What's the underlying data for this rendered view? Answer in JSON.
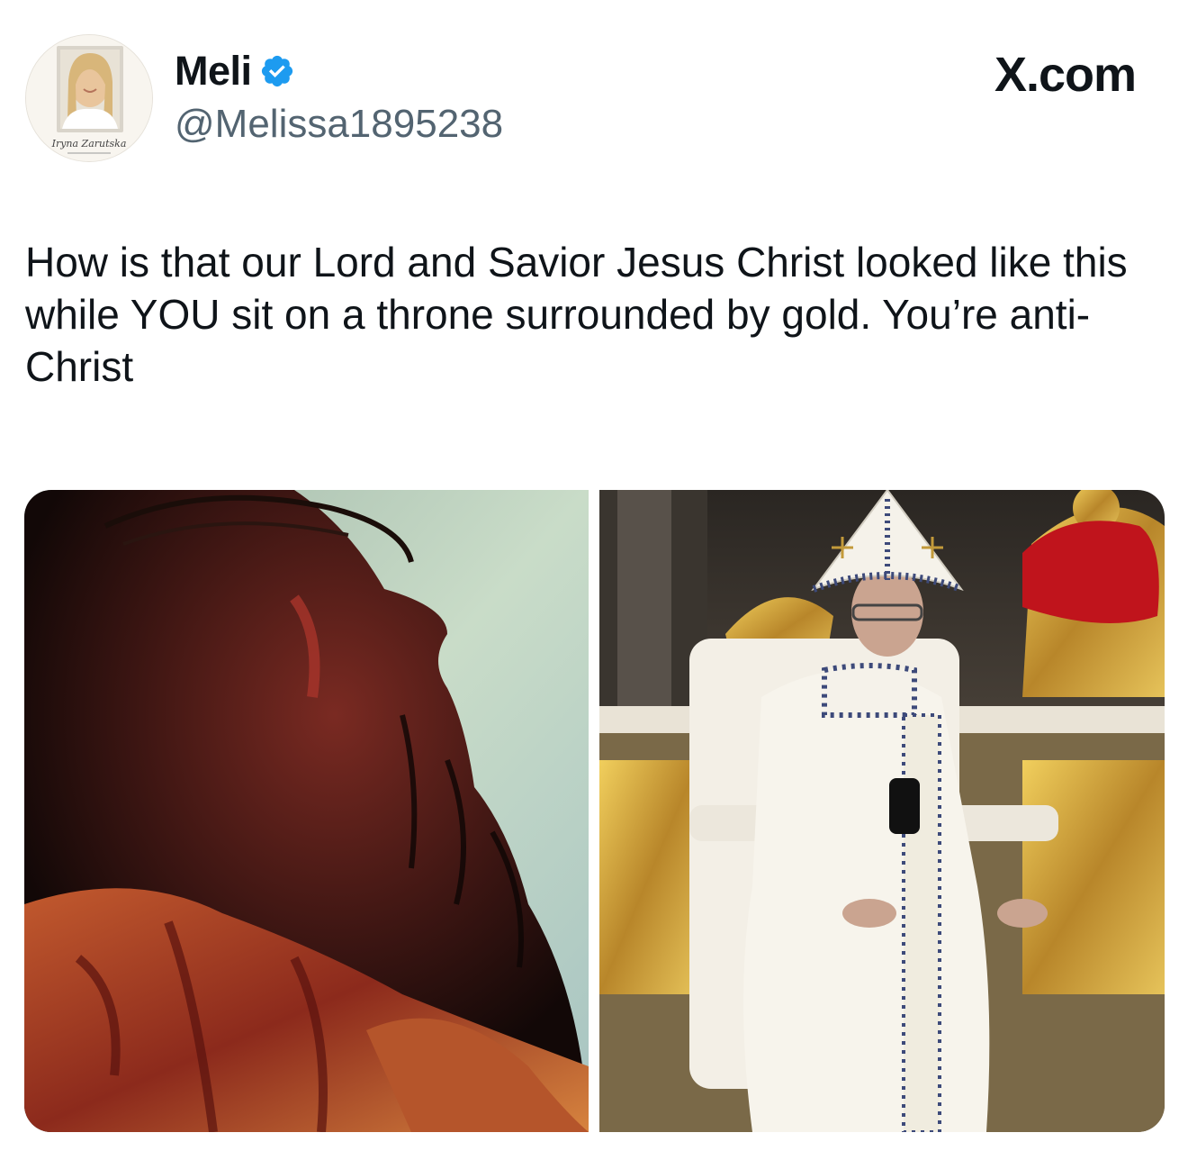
{
  "tweet": {
    "author": {
      "display_name": "Meli",
      "handle": "@Melissa1895238",
      "verified": true,
      "avatar_caption": "Iryna Zarutska"
    },
    "site_label": "X.com",
    "text": "How is that our Lord and Savior Jesus Christ looked like this while YOU sit on a throne surrounded by gold. You’re anti-Christ",
    "media": [
      {
        "kind": "photo"
      },
      {
        "kind": "photo"
      }
    ]
  },
  "colors": {
    "verified_blue": "#1d9bf0",
    "text_primary": "#0f1419",
    "text_secondary": "#536471"
  },
  "icons": {
    "verified": "verified-badge-icon"
  }
}
